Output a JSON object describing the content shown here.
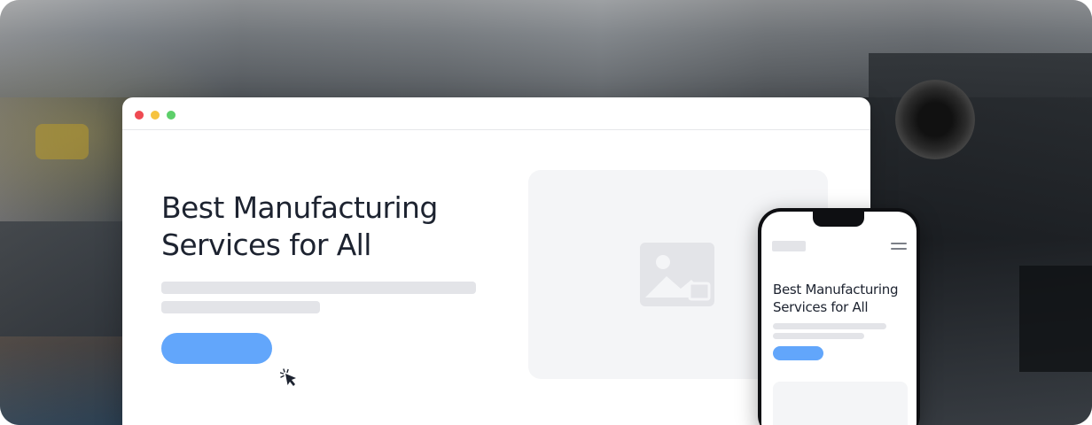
{
  "hero": {
    "title": "Best Manufacturing Services for All"
  },
  "mobile": {
    "title": "Best Manufacturing Services for All"
  },
  "icons": {
    "window_controls": [
      "close-dot",
      "minimize-dot",
      "maximize-dot"
    ],
    "image_placeholder": "image-icon",
    "cursor": "click-cursor-icon",
    "menu": "hamburger-menu-icon"
  },
  "colors": {
    "accent": "#62a6fb",
    "skeleton": "#e3e4e8",
    "placeholder_bg": "#f4f5f7",
    "title_text": "#1d2330"
  }
}
